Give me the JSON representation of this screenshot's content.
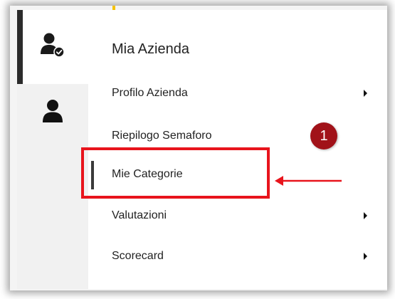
{
  "sidebar": {
    "items": [
      {
        "icon": "user-check-icon",
        "active": true
      },
      {
        "icon": "user-icon",
        "active": false
      }
    ]
  },
  "menu": {
    "title": "Mia Azienda",
    "items": [
      {
        "label": "Profilo Azienda",
        "has_submenu": true
      },
      {
        "label": "Riepilogo Semaforo",
        "has_submenu": false
      },
      {
        "label": "Mie Categorie",
        "has_submenu": false,
        "selected": true
      },
      {
        "label": "Valutazioni",
        "has_submenu": true
      },
      {
        "label": "Scorecard",
        "has_submenu": true
      }
    ]
  },
  "annotation": {
    "badge_number": "1",
    "color": "#e8141c",
    "badge_color": "#a11219"
  },
  "colors": {
    "accent_yellow": "#f5c200",
    "active_bar": "#2b2b2b"
  }
}
